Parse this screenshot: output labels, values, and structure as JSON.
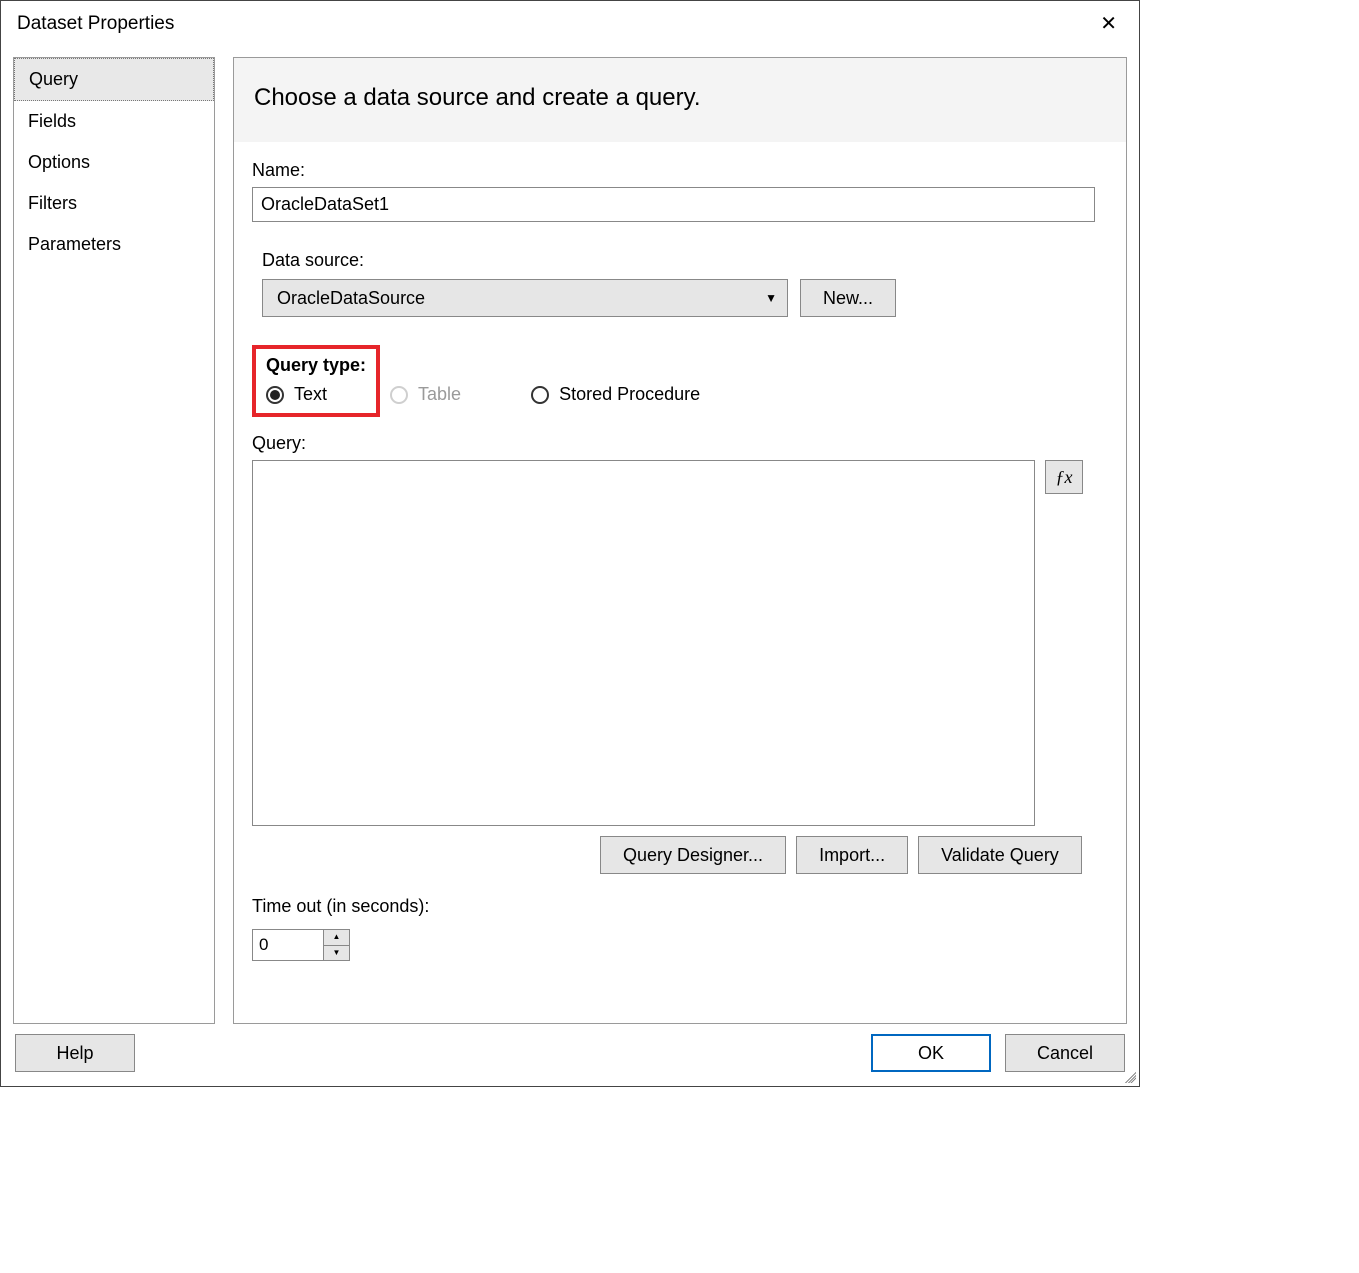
{
  "dialog": {
    "title": "Dataset Properties",
    "close": "✕"
  },
  "nav": {
    "items": [
      {
        "label": "Query",
        "selected": true
      },
      {
        "label": "Fields"
      },
      {
        "label": "Options"
      },
      {
        "label": "Filters"
      },
      {
        "label": "Parameters"
      }
    ]
  },
  "header": {
    "text": "Choose a data source and create a query."
  },
  "form": {
    "name_label": "Name:",
    "name_value": "OracleDataSet1",
    "datasource_label": "Data source:",
    "datasource_value": "OracleDataSource",
    "new_button": "New...",
    "querytype_label": "Query type:",
    "querytype_options": {
      "text": "Text",
      "table": "Table",
      "stored": "Stored Procedure"
    },
    "query_label": "Query:",
    "query_value": "",
    "fx_label": "ƒx",
    "buttons": {
      "designer": "Query Designer...",
      "import": "Import...",
      "validate": "Validate Query"
    },
    "timeout_label": "Time out (in seconds):",
    "timeout_value": "0"
  },
  "footer": {
    "help": "Help",
    "ok": "OK",
    "cancel": "Cancel"
  }
}
